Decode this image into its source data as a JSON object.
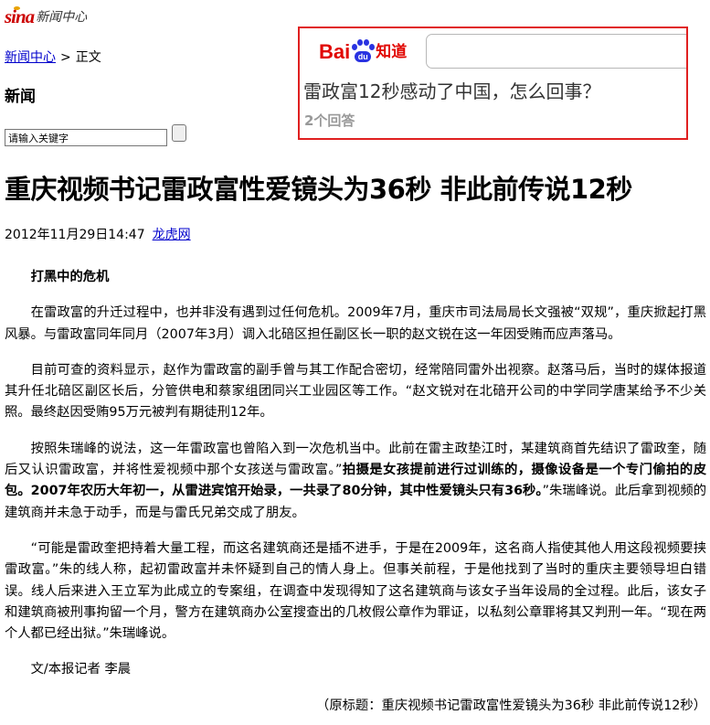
{
  "header": {
    "logo_sina": "sina",
    "logo_cn": "新闻中心"
  },
  "breadcrumb": {
    "home": "新闻中心",
    "separator": ">",
    "current": "正文"
  },
  "section": {
    "title": "新闻"
  },
  "search": {
    "placeholder": "请输入关键字"
  },
  "baidu_ad": {
    "brand_text": "Bai",
    "paw_label": "du",
    "brand_suffix": "知道",
    "question": "雷政富12秒感动了中国，怎么回事？",
    "answers": "2个回答",
    "colors": {
      "border": "#e02020",
      "brand_red": "#e10601",
      "brand_blue": "#2932e1"
    }
  },
  "article": {
    "headline": "重庆视频书记雷政富性爱镜头为36秒 非此前传说12秒",
    "date": "2012年11月29日14:47",
    "source": "龙虎网",
    "subheading": "打黑中的危机",
    "p1": "在雷政富的升迁过程中，也并非没有遇到过任何危机。2009年7月，重庆市司法局局长文强被“双规”，重庆掀起打黑风暴。与雷政富同年同月（2007年3月）调入北碚区担任副区长一职的赵文锐在这一年因受贿而应声落马。",
    "p2": "目前可查的资料显示，赵作为雷政富的副手曾与其工作配合密切，经常陪同雷外出视察。赵落马后，当时的媒体报道其升任北碚区副区长后，分管供电和蔡家组团同兴工业园区等工作。“赵文锐对在北碚开公司的中学同学唐某给予不少关照。最终赵因受贿95万元被判有期徒刑12年。",
    "p3_a": "按照朱瑞峰的说法，这一年雷政富也曾陷入到一次危机当中。此前在雷主政垫江时，某建筑商首先结识了雷政奎，随后又认识雷政富，并将性爱视频中那个女孩送与雷政富。”",
    "p3_bold": "拍摄是女孩提前进行过训练的，摄像设备是一个专门偷拍的皮包。2007年农历大年初一，从雷进宾馆开始录，一共录了80分钟，其中性爱镜头只有36秒。",
    "p3_b": "”朱瑞峰说。此后拿到视频的建筑商并未急于动手，而是与雷氏兄弟交成了朋友。",
    "p4": "“可能是雷政奎把持着大量工程，而这名建筑商还是插不进手，于是在2009年，这名商人指使其他人用这段视频要挟雷政富。”朱的线人称，起初雷政富并未怀疑到自己的情人身上。但事关前程，于是他找到了当时的重庆主要领导坦白错误。线人后来进入王立军为此成立的专案组，在调查中发现得知了这名建筑商与该女子当年设局的全过程。此后，该女子和建筑商被刑事拘留一个月，警方在建筑商办公室搜查出的几枚假公章作为罪证，以私刻公章罪将其又判刑一年。“现在两个人都已经出狱。”朱瑞峰说。",
    "byline": "文/本报记者 李晨",
    "original_title": "（原标题：重庆视频书记雷政富性爱镜头为36秒 非此前传说12秒）"
  }
}
